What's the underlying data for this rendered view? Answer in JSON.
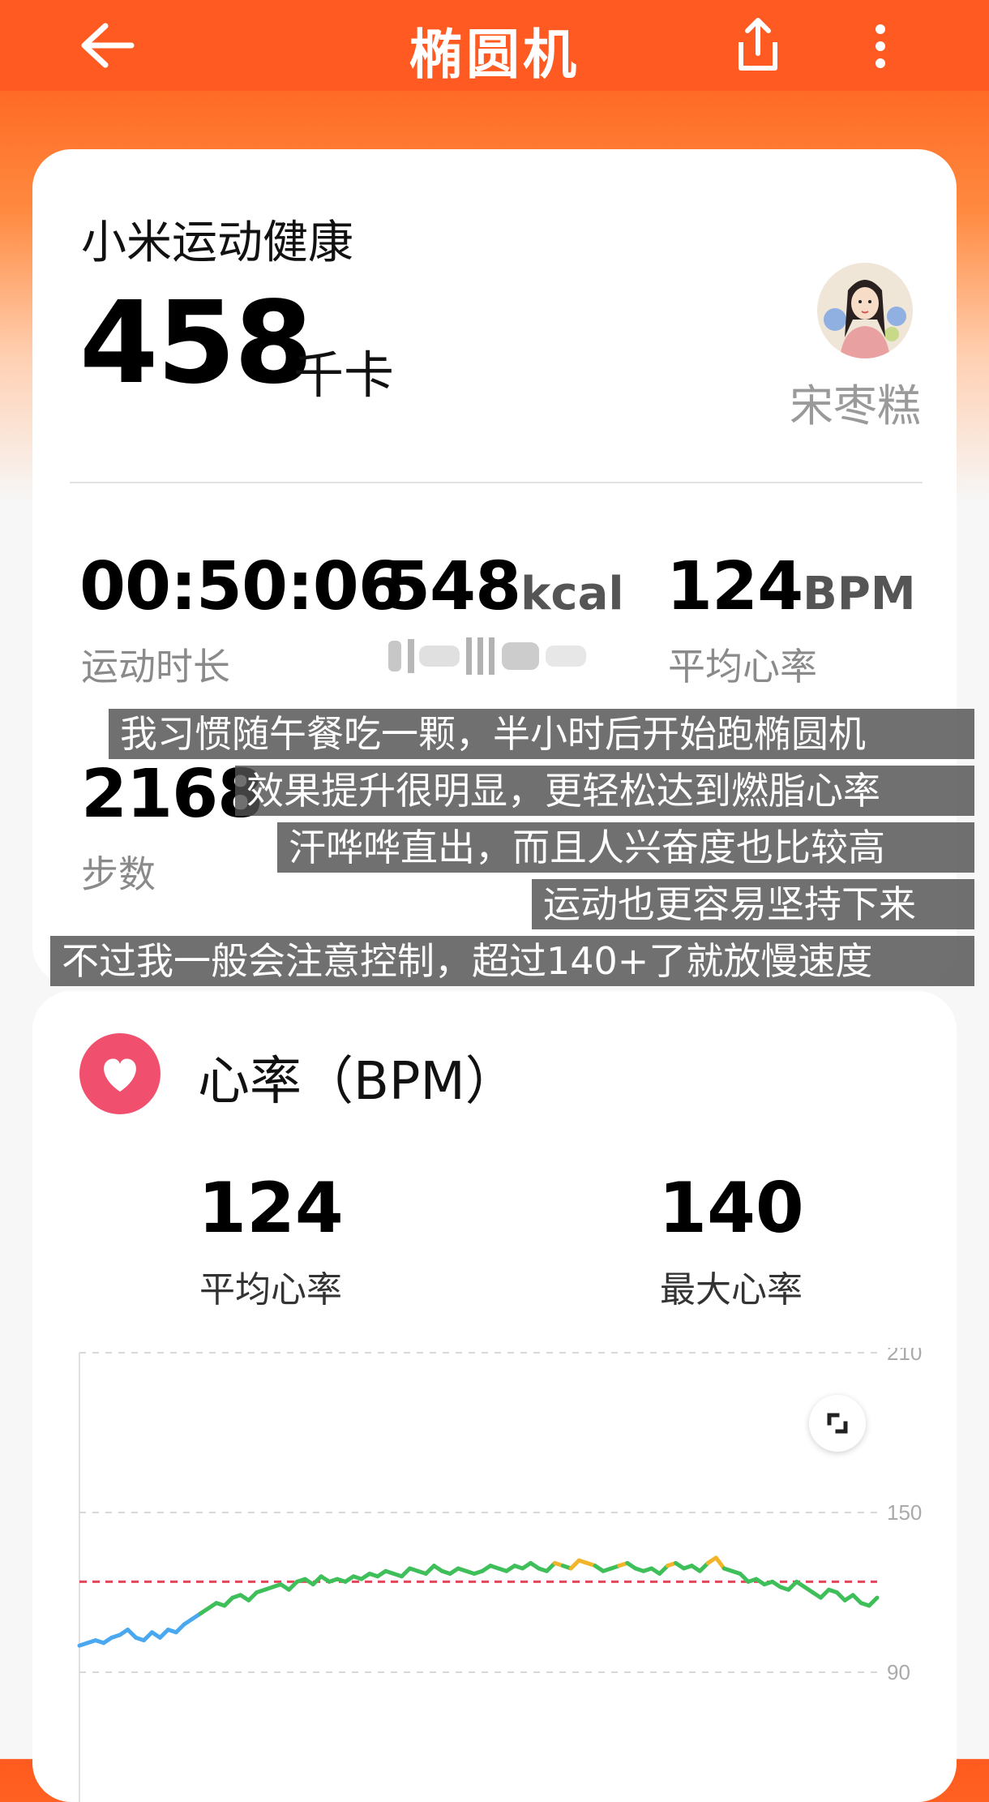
{
  "header": {
    "title": "椭圆机",
    "icons": {
      "back": "back-arrow-icon",
      "share": "share-icon",
      "more": "more-vertical-icon"
    }
  },
  "summary": {
    "app_name": "小米运动健康",
    "calories_value": "458",
    "calories_unit": "千卡",
    "username": "宋枣糕",
    "stats": [
      {
        "value": "00:50:06",
        "unit": "",
        "label": "运动时长"
      },
      {
        "value": "548",
        "unit": "kcal",
        "label": ""
      },
      {
        "value": "124",
        "unit": "BPM",
        "label": "平均心率"
      }
    ],
    "steps_value": "2168",
    "steps_label": "步数"
  },
  "captions": [
    "我习惯随午餐吃一颗，半小时后开始跑椭圆机",
    "效果提升很明显，更轻松达到燃脂心率",
    "汗哗哗直出，而且人兴奋度也比较高",
    "运动也更容易坚持下来",
    "不过我一般会注意控制，超过140+了就放慢速度"
  ],
  "heart_rate": {
    "title": "心率（BPM）",
    "avg_value": "124",
    "avg_label": "平均心率",
    "max_value": "140",
    "max_label": "最大心率",
    "colors": {
      "heart_icon": "#f0506e",
      "zone_low": "#4aa8f0",
      "zone_mid": "#3fbf5a",
      "zone_high": "#f2b52a",
      "avg_line": "#e4455a"
    }
  },
  "chart_data": {
    "type": "line",
    "y_ticks": [
      210,
      150,
      90
    ],
    "ylim": [
      90,
      210
    ],
    "avg_reference": 124,
    "zone_thresholds": {
      "low_below": 112,
      "high_above": 130
    },
    "x": [
      0,
      1,
      2,
      3,
      4,
      5,
      6,
      7,
      8,
      9,
      10,
      11,
      12,
      13,
      14,
      15,
      16,
      17,
      18,
      19,
      20,
      21,
      22,
      23,
      24,
      25,
      26,
      27,
      28,
      29,
      30,
      31,
      32,
      33,
      34,
      35,
      36,
      37,
      38,
      39,
      40,
      41,
      42,
      43,
      44,
      45,
      46,
      47,
      48,
      49,
      50,
      51,
      52,
      53,
      54,
      55,
      56,
      57,
      58,
      59,
      60,
      61,
      62,
      63,
      64,
      65,
      66,
      67,
      68,
      69,
      70,
      71,
      72,
      73,
      74,
      75,
      76,
      77,
      78,
      79,
      80,
      81,
      82,
      83,
      84,
      85,
      86,
      87,
      88,
      89,
      90,
      91,
      92,
      93,
      94,
      95,
      96,
      97,
      98,
      99
    ],
    "series": [
      {
        "values": [
          100,
          101,
          102,
          101,
          103,
          104,
          106,
          103,
          102,
          105,
          103,
          106,
          105,
          108,
          110,
          112,
          114,
          116,
          115,
          118,
          119,
          117,
          120,
          121,
          122,
          123,
          121,
          124,
          125,
          123,
          126,
          124,
          125,
          124,
          126,
          125,
          127,
          126,
          128,
          127,
          126,
          129,
          128,
          127,
          130,
          128,
          127,
          129,
          128,
          127,
          128,
          130,
          129,
          128,
          130,
          129,
          131,
          129,
          128,
          131,
          130,
          129,
          132,
          131,
          130,
          128,
          129,
          130,
          131,
          129,
          128,
          129,
          127,
          130,
          131,
          129,
          130,
          128,
          131,
          133,
          129,
          128,
          127,
          124,
          125,
          123,
          124,
          122,
          121,
          124,
          122,
          120,
          118,
          121,
          120,
          117,
          119,
          116,
          115,
          118
        ]
      }
    ]
  }
}
